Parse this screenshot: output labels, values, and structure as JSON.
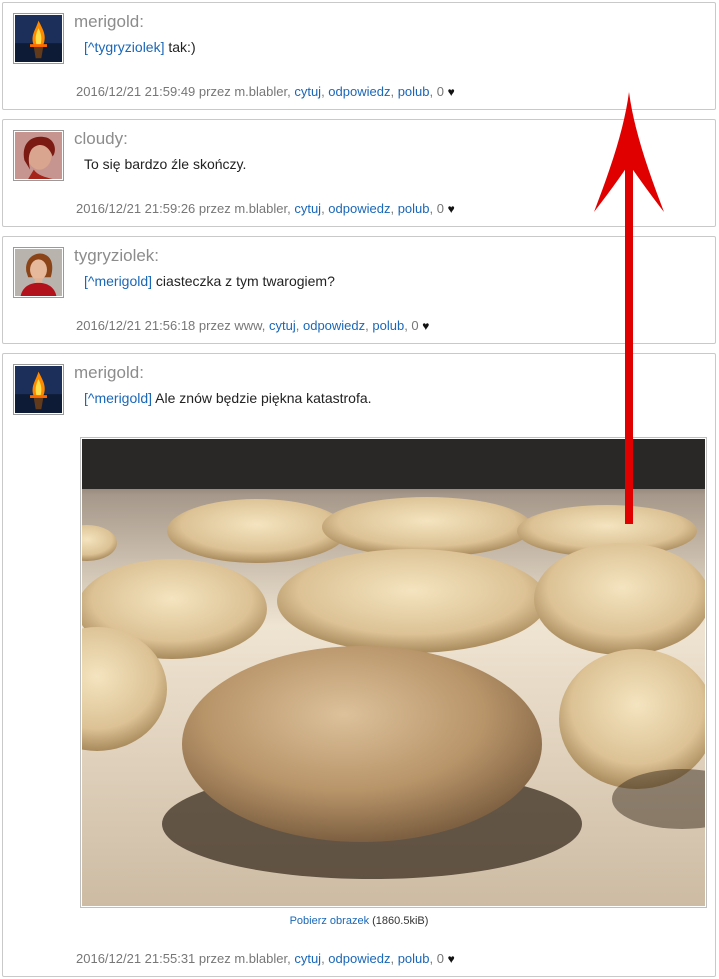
{
  "posts": [
    {
      "author": "merigold:",
      "mention": "[^tygryziolek]",
      "text": " tak:)",
      "timestamp": "2016/12/21 21:59:49",
      "by_prefix": "przez",
      "by_user": "m.blabler,",
      "quote": "cytuj",
      "reply": "odpowiedz",
      "like": "polub",
      "likes_count": "0",
      "avatar": "bonfire-avatar"
    },
    {
      "author": "cloudy:",
      "mention": "",
      "text": "To się bardzo źle skończy.",
      "timestamp": "2016/12/21 21:59:26",
      "by_prefix": "przez",
      "by_user": "m.blabler,",
      "quote": "cytuj",
      "reply": "odpowiedz",
      "like": "polub",
      "likes_count": "0",
      "avatar": "red-portrait-avatar"
    },
    {
      "author": "tygryziolek:",
      "mention": "[^merigold]",
      "text": " ciasteczka z tym twarogiem?",
      "timestamp": "2016/12/21 21:56:18",
      "by_prefix": "przez",
      "by_user": "www,",
      "quote": "cytuj",
      "reply": "odpowiedz",
      "like": "polub",
      "likes_count": "0",
      "avatar": "woman-portrait-avatar"
    },
    {
      "author": "merigold:",
      "mention": "[^merigold]",
      "text": " Ale znów będzie piękna katastrofa.",
      "timestamp": "2016/12/21 21:55:31",
      "by_prefix": "przez",
      "by_user": "m.blabler,",
      "quote": "cytuj",
      "reply": "odpowiedz",
      "like": "polub",
      "likes_count": "0",
      "avatar": "bonfire-avatar",
      "image": {
        "download_label": "Pobierz obrazek",
        "size": "(1860.5kiB)"
      }
    }
  ],
  "colors": {
    "link": "#1a67b8",
    "author": "#8c8c8c",
    "arrow": "#e00000"
  }
}
